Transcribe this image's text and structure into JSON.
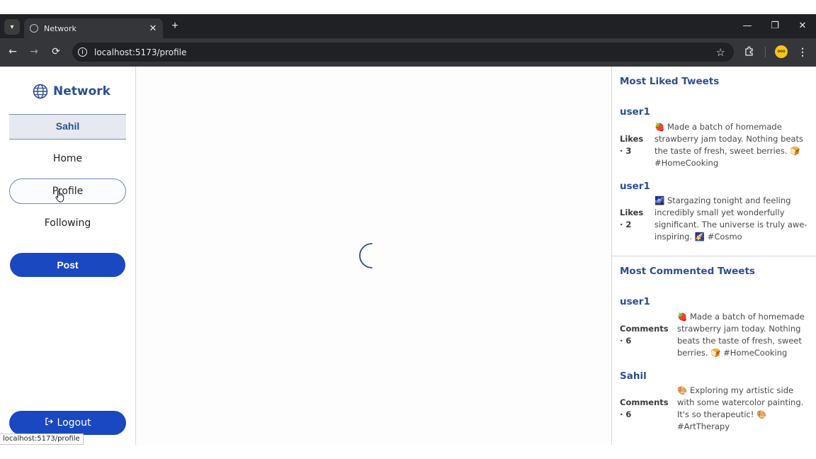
{
  "browser": {
    "tab_title": "Network",
    "tab_close": "✕",
    "new_tab": "+",
    "url": "localhost:5173/profile",
    "win_minimize": "—",
    "win_restore": "❐",
    "win_close": "✕",
    "back": "←",
    "forward": "→",
    "reload": "⟳",
    "star": "☆",
    "profile_avatar_text": "ooo",
    "status_url": "localhost:5173/profile"
  },
  "sidebar": {
    "brand": "Network",
    "username": "Sahil",
    "items": [
      {
        "label": "Home"
      },
      {
        "label": "Profile"
      },
      {
        "label": "Following"
      }
    ],
    "post_label": "Post",
    "logout_label": "Logout"
  },
  "right": {
    "liked_title": "Most Liked Tweets",
    "commented_title": "Most Commented Tweets",
    "liked": [
      {
        "user": "user1",
        "meta_label": "Likes",
        "meta_value": "· 3",
        "text": "🍓 Made a batch of homemade strawberry jam today. Nothing beats the taste of fresh, sweet berries. 🍞 #HomeCooking"
      },
      {
        "user": "user1",
        "meta_label": "Likes",
        "meta_value": "· 2",
        "text": "🌌 Stargazing tonight and feeling incredibly small yet wonderfully significant. The universe is truly awe-inspiring. 🌠 #Cosmo"
      }
    ],
    "commented": [
      {
        "user": "user1",
        "meta_label": "Comments",
        "meta_value": "· 6",
        "text": "🍓 Made a batch of homemade strawberry jam today. Nothing beats the taste of fresh, sweet berries. 🍞 #HomeCooking"
      },
      {
        "user": "Sahil",
        "meta_label": "Comments",
        "meta_value": "· 6",
        "text": "🎨 Exploring my artistic side with some watercolor painting. It's so therapeutic! 🎨 #ArtTherapy"
      }
    ]
  },
  "colors": {
    "brand_blue": "#2d4e93",
    "button_blue": "#1a48c1",
    "chrome_dark": "#202124"
  }
}
